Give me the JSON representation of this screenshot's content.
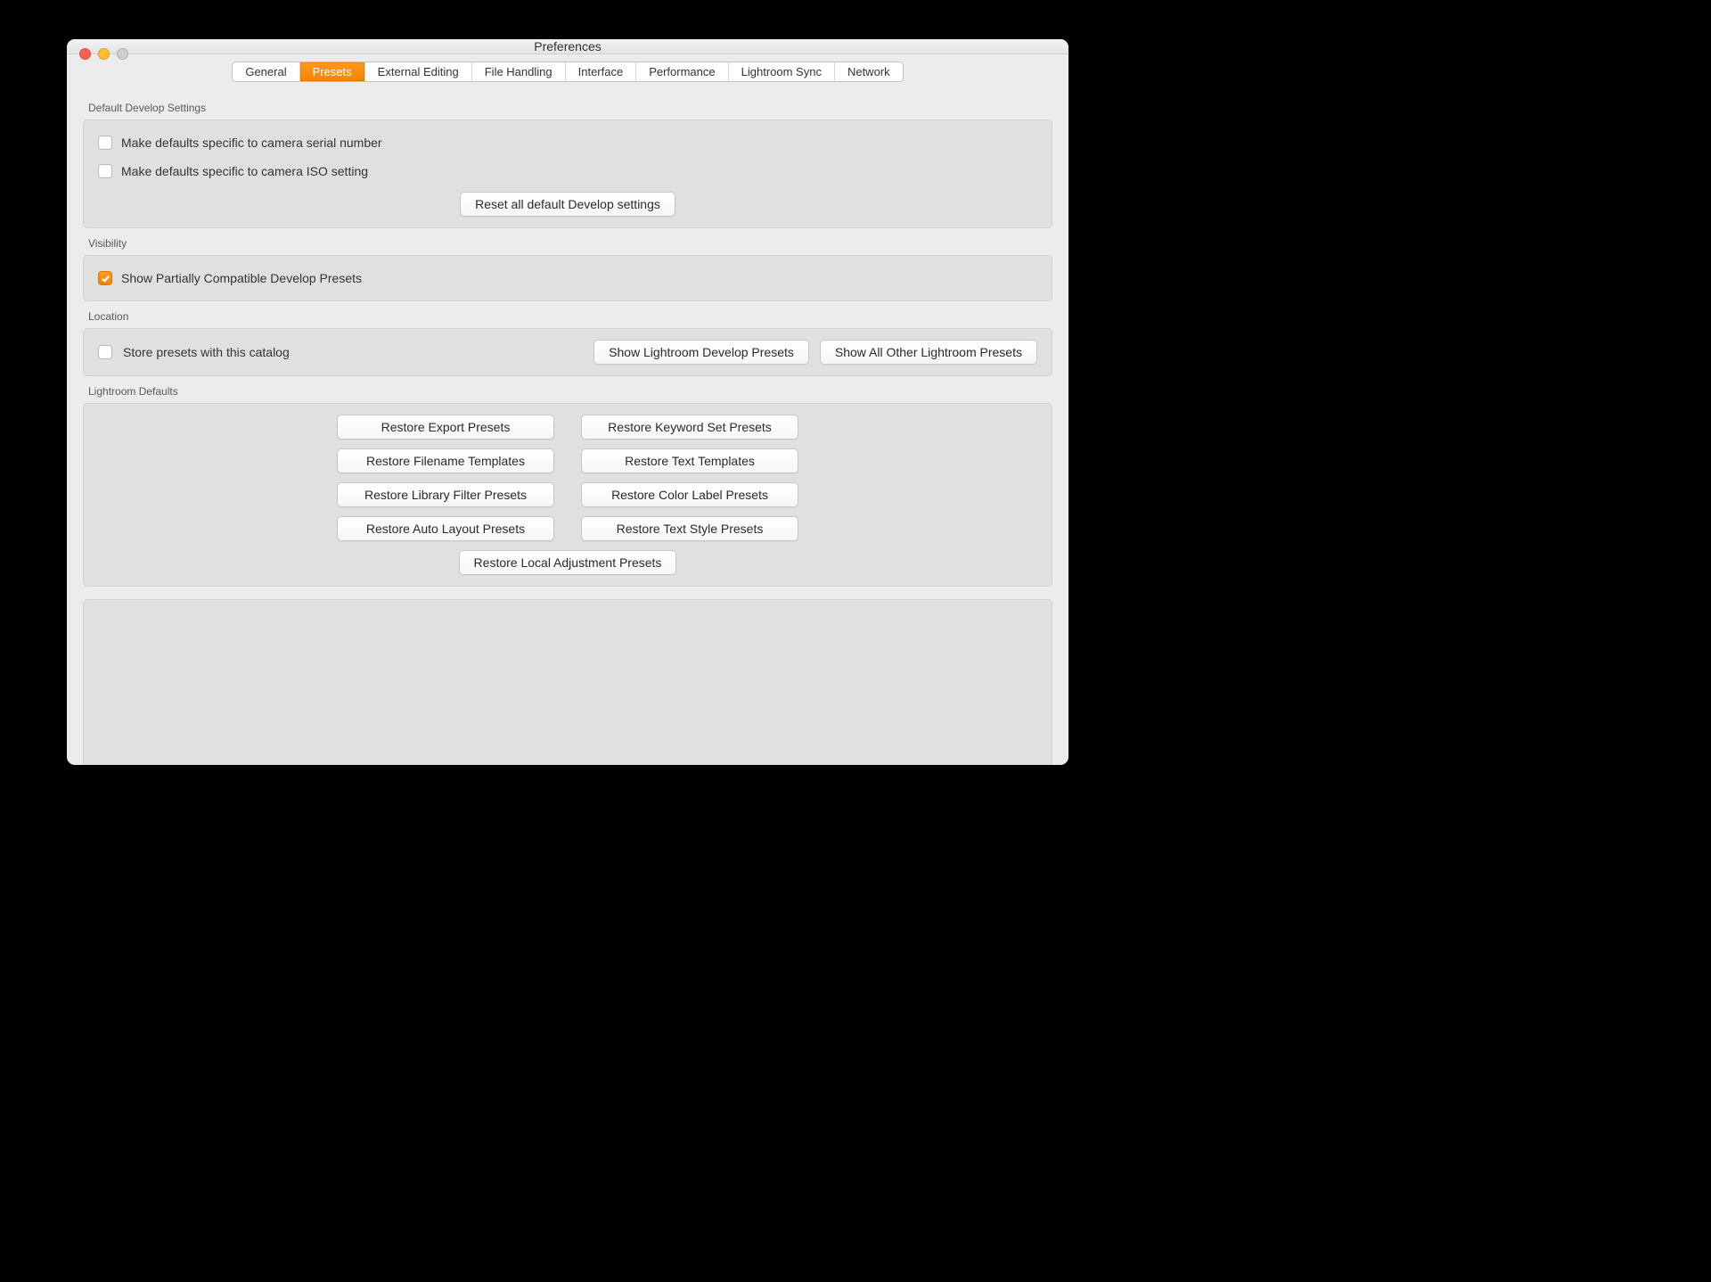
{
  "window": {
    "title": "Preferences"
  },
  "tabs": {
    "general": "General",
    "presets": "Presets",
    "external_editing": "External Editing",
    "file_handling": "File Handling",
    "interface": "Interface",
    "performance": "Performance",
    "lightroom_sync": "Lightroom Sync",
    "network": "Network",
    "active": "presets"
  },
  "sections": {
    "default_develop_settings": {
      "label": "Default Develop Settings",
      "make_defaults_serial": "Make defaults specific to camera serial number",
      "make_defaults_iso": "Make defaults specific to camera ISO setting",
      "reset_button": "Reset all default Develop settings"
    },
    "visibility": {
      "label": "Visibility",
      "show_partially_compatible": "Show Partially Compatible Develop Presets"
    },
    "location": {
      "label": "Location",
      "store_with_catalog": "Store presets with this catalog",
      "show_develop_presets": "Show Lightroom Develop Presets",
      "show_all_other_presets": "Show All Other Lightroom Presets"
    },
    "lightroom_defaults": {
      "label": "Lightroom Defaults",
      "restore_export": "Restore Export Presets",
      "restore_keyword_set": "Restore Keyword Set Presets",
      "restore_filename_templates": "Restore Filename Templates",
      "restore_text_templates": "Restore Text Templates",
      "restore_library_filter": "Restore Library Filter Presets",
      "restore_color_label": "Restore Color Label Presets",
      "restore_auto_layout": "Restore Auto Layout Presets",
      "restore_text_style": "Restore Text Style Presets",
      "restore_local_adjustment": "Restore Local Adjustment Presets"
    }
  }
}
